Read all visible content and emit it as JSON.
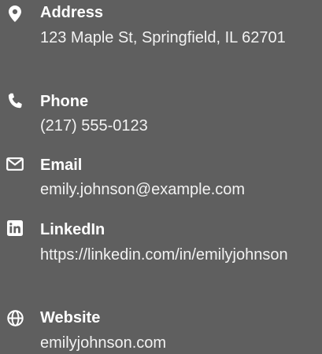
{
  "contacts": {
    "address": {
      "icon": "map-pin-icon",
      "label": "Address",
      "value": "123 Maple St, Springfield, IL 62701"
    },
    "phone": {
      "icon": "phone-icon",
      "label": "Phone",
      "value": "(217) 555-0123"
    },
    "email": {
      "icon": "envelope-icon",
      "label": "Email",
      "value": "emily.johnson@example.com"
    },
    "linkedin": {
      "icon": "linkedin-icon",
      "label": "LinkedIn",
      "value": "https://linkedin.com/in/emilyjohnson"
    },
    "website": {
      "icon": "globe-icon",
      "label": "Website",
      "value": "emilyjohnson.com"
    }
  },
  "colors": {
    "background": "#5f5f5f",
    "text": "#ffffff"
  }
}
